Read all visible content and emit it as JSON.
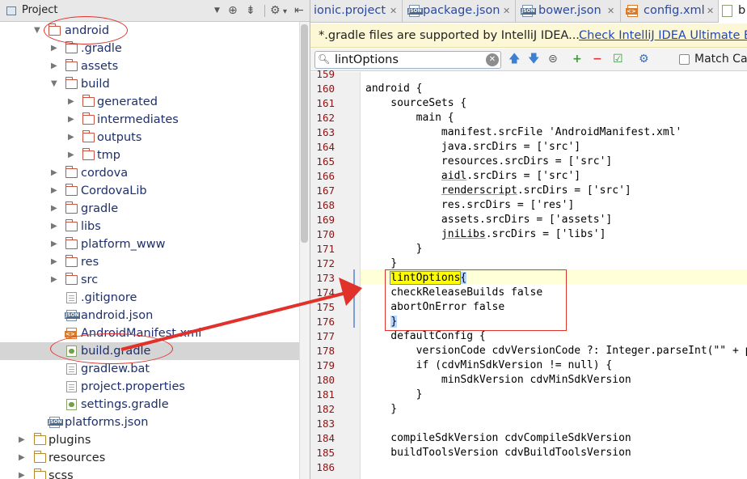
{
  "project_panel": {
    "title": "Project",
    "tree": [
      {
        "label": "android",
        "type": "folder",
        "level": 0,
        "expanded": true
      },
      {
        "label": ".gradle",
        "type": "folder",
        "level": 1,
        "expanded": false
      },
      {
        "label": "assets",
        "type": "folder",
        "level": 1,
        "expanded": false
      },
      {
        "label": "build",
        "type": "folder",
        "level": 1,
        "expanded": true
      },
      {
        "label": "generated",
        "type": "folder",
        "level": 2,
        "expanded": false
      },
      {
        "label": "intermediates",
        "type": "folder",
        "level": 2,
        "expanded": false
      },
      {
        "label": "outputs",
        "type": "folder",
        "level": 2,
        "expanded": false
      },
      {
        "label": "tmp",
        "type": "folder",
        "level": 2,
        "expanded": false
      },
      {
        "label": "cordova",
        "type": "folder",
        "level": 1,
        "expanded": false
      },
      {
        "label": "CordovaLib",
        "type": "folder",
        "level": 1,
        "expanded": false
      },
      {
        "label": "gradle",
        "type": "folder",
        "level": 1,
        "expanded": false
      },
      {
        "label": "libs",
        "type": "folder",
        "level": 1,
        "expanded": false
      },
      {
        "label": "platform_www",
        "type": "folder",
        "level": 1,
        "expanded": false
      },
      {
        "label": "res",
        "type": "folder",
        "level": 1,
        "expanded": false
      },
      {
        "label": "src",
        "type": "folder",
        "level": 1,
        "expanded": false
      },
      {
        "label": ".gitignore",
        "type": "file-txt",
        "level": 1
      },
      {
        "label": "android.json",
        "type": "file-json",
        "level": 1
      },
      {
        "label": "AndroidManifest.xml",
        "type": "file-xml",
        "level": 1
      },
      {
        "label": "build.gradle",
        "type": "file-gradle",
        "level": 1,
        "selected": true
      },
      {
        "label": "gradlew.bat",
        "type": "file-txt",
        "level": 1
      },
      {
        "label": "project.properties",
        "type": "file-txt",
        "level": 1
      },
      {
        "label": "settings.gradle",
        "type": "file-gradle",
        "level": 1
      },
      {
        "label": "platforms.json",
        "type": "file-json",
        "level": 0
      },
      {
        "label": "plugins",
        "type": "folder-tan",
        "level": -1,
        "expanded": false
      },
      {
        "label": "resources",
        "type": "folder-tan",
        "level": -1,
        "expanded": false
      },
      {
        "label": "scss",
        "type": "folder-tan",
        "level": -1,
        "expanded": false
      }
    ]
  },
  "tabs": [
    {
      "label": "ionic.project",
      "icon": "none",
      "active": false
    },
    {
      "label": "package.json",
      "icon": "json",
      "active": false
    },
    {
      "label": "bower.json",
      "icon": "json",
      "active": false
    },
    {
      "label": "config.xml",
      "icon": "xml",
      "active": false
    },
    {
      "label": "b",
      "icon": "gradle",
      "active": true
    }
  ],
  "banner": {
    "text": "*.gradle files are supported by IntelliJ IDEA...",
    "link": "Check IntelliJ IDEA Ultimate E"
  },
  "search": {
    "value": "lintOptions",
    "match_case_label": "Match Cas"
  },
  "code": {
    "line_numbers": [
      "159",
      "160",
      "161",
      "162",
      "163",
      "164",
      "165",
      "166",
      "167",
      "168",
      "169",
      "170",
      "171",
      "172",
      "173",
      "174",
      "175",
      "176",
      "177",
      "178",
      "179",
      "180",
      "181",
      "182",
      "183",
      "184",
      "185",
      "186"
    ],
    "lines": [
      "",
      "android {",
      "    sourceSets {",
      "        main {",
      "            manifest.srcFile 'AndroidManifest.xml'",
      "            java.srcDirs = ['src']",
      "            resources.srcDirs = ['src']",
      "            aidl.srcDirs = ['src']",
      "            renderscript.srcDirs = ['src']",
      "            res.srcDirs = ['res']",
      "            assets.srcDirs = ['assets']",
      "            jniLibs.srcDirs = ['libs']",
      "        }",
      "    }",
      "    lintOptions{",
      "    checkReleaseBuilds false",
      "    abortOnError false",
      "    }",
      "    defaultConfig {",
      "        versionCode cdvVersionCode ?: Integer.parseInt(\"\" + p",
      "        if (cdvMinSdkVersion != null) {",
      "            minSdkVersion cdvMinSdkVersion",
      "        }",
      "    }",
      "",
      "    compileSdkVersion cdvCompileSdkVersion",
      "    buildToolsVersion cdvBuildToolsVersion",
      ""
    ],
    "current_line": "173",
    "search_match": "lintOptions"
  },
  "colors": {
    "line_number": "#8a1414",
    "folder": "#c85340",
    "annotation_red": "#e0312a",
    "search_highlight": "#ffff00"
  }
}
